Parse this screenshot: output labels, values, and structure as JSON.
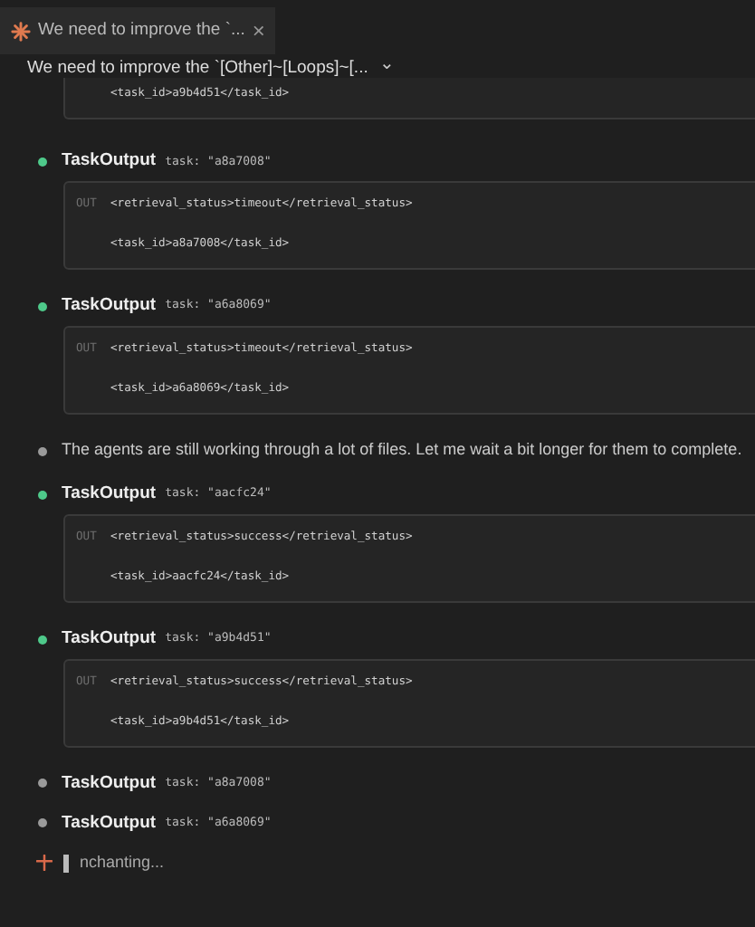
{
  "tab": {
    "title": "We need to improve the `...",
    "close": "×"
  },
  "header": {
    "title": "We need to improve the `[Other]~[Loops]~[...",
    "caret": "⌄"
  },
  "items": [
    {
      "kind": "output",
      "lines": [
        "<task_id>a9b4d51</task_id>"
      ]
    },
    {
      "kind": "tool",
      "color": "#4ec98a",
      "name": "TaskOutput",
      "args": "task: \"a8a7008\"",
      "out_label": "OUT",
      "lines": [
        "<retrieval_status>timeout</retrieval_status>",
        "<task_id>a8a7008</task_id>"
      ]
    },
    {
      "kind": "tool",
      "color": "#4ec98a",
      "name": "TaskOutput",
      "args": "task: \"a6a8069\"",
      "out_label": "OUT",
      "lines": [
        "<retrieval_status>timeout</retrieval_status>",
        "<task_id>a6a8069</task_id>"
      ]
    },
    {
      "kind": "message",
      "color": "#9a9a9a",
      "text": "The agents are still working through a lot of files. Let me wait a bit longer for them to complete."
    },
    {
      "kind": "tool",
      "color": "#4ec98a",
      "name": "TaskOutput",
      "args": "task: \"aacfc24\"",
      "out_label": "OUT",
      "lines": [
        "<retrieval_status>success</retrieval_status>",
        "<task_id>aacfc24</task_id>"
      ]
    },
    {
      "kind": "tool",
      "color": "#4ec98a",
      "name": "TaskOutput",
      "args": "task: \"a9b4d51\"",
      "out_label": "OUT",
      "lines": [
        "<retrieval_status>success</retrieval_status>",
        "<task_id>a9b4d51</task_id>"
      ]
    },
    {
      "kind": "tool",
      "color": "#9a9a9a",
      "name": "TaskOutput",
      "args": "task: \"a8a7008\""
    },
    {
      "kind": "tool",
      "color": "#9a9a9a",
      "name": "TaskOutput",
      "args": "task: \"a6a8069\""
    }
  ],
  "status": {
    "text": "nchanting..."
  }
}
